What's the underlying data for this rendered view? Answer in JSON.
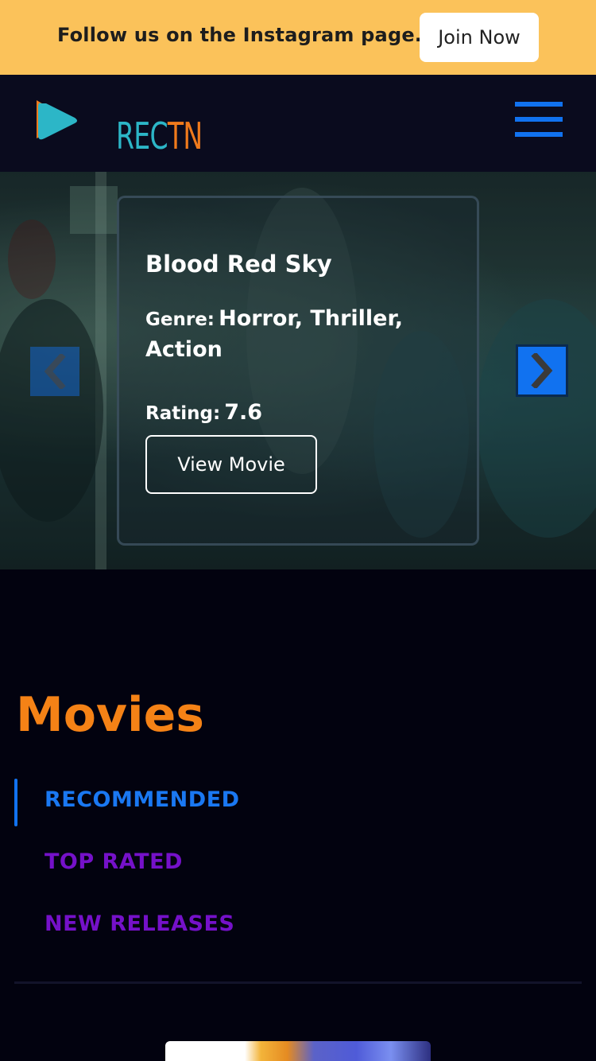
{
  "promo": {
    "text": "Follow us on the Instagram page.",
    "button_label": "Join Now"
  },
  "navbar": {
    "logo_text_rec": "REC",
    "logo_text_tn": "TN",
    "menu_icon": "hamburger-menu-icon"
  },
  "hero": {
    "title": "Blood Red Sky",
    "genre_label": "Genre:",
    "genre_value": "Horror, Thriller, Action",
    "rating_label": "Rating:",
    "rating_value": "7.6",
    "button_label": "View Movie",
    "prev_icon": "chevron-left-icon",
    "next_icon": "chevron-right-icon"
  },
  "movies": {
    "title": "Movies",
    "tabs": [
      {
        "label": "RECOMMENDED",
        "active": true
      },
      {
        "label": "TOP RATED",
        "active": false
      },
      {
        "label": "NEW RELEASES",
        "active": false
      }
    ]
  },
  "colors": {
    "promo_bg": "#fbc25a",
    "navbar_bg": "#0a0b1e",
    "page_bg": "#02020f",
    "accent_orange": "#f58216",
    "accent_blue": "#1172f0",
    "accent_purple": "#7511c9",
    "logo_teal": "#2cb6c7"
  }
}
